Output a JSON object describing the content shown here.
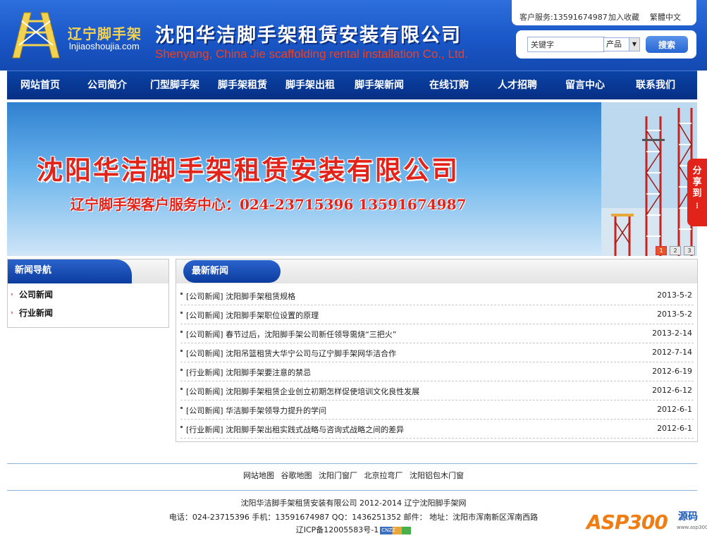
{
  "header": {
    "logo_cn": "辽宁脚手架",
    "logo_url": "lnjiaoshoujia.com",
    "company_cn": "沈阳华洁脚手架租赁安装有限公司",
    "company_en": "Shenyang, China Jie scaffolding rental installation Co., Ltd.",
    "service_phone": "客户服务:13591674987",
    "favorite": "加入收藏",
    "traditional": "繁體中文",
    "search_value": "关键字",
    "search_select": "产品",
    "search_button": "搜索"
  },
  "nav": [
    "网站首页",
    "公司简介",
    "门型脚手架",
    "脚手架租赁",
    "脚手架出租",
    "脚手架新闻",
    "在线订购",
    "人才招聘",
    "留言中心",
    "联系我们"
  ],
  "banner": {
    "title": "沈阳华洁脚手架租赁安装有限公司",
    "subtitle": "辽宁脚手架客户服务中心：024-23715396  13591674987",
    "dots": [
      "1",
      "2",
      "3"
    ],
    "share": "分享到"
  },
  "sidebar": {
    "title": "新闻导航",
    "items": [
      "公司新闻",
      "行业新闻"
    ]
  },
  "news": {
    "title": "最新新闻",
    "items": [
      {
        "title": "[公司新闻] 沈阳脚手架租赁规格",
        "date": "2013-5-2"
      },
      {
        "title": "[公司新闻] 沈阳脚手架职位设置的原理",
        "date": "2013-5-2"
      },
      {
        "title": "[公司新闻] 春节过后，沈阳脚手架公司新任领导需烧“三把火”",
        "date": "2013-2-14"
      },
      {
        "title": "[公司新闻] 沈阳吊篮租赁大华宁公司与辽宁脚手架网华洁合作",
        "date": "2012-7-14"
      },
      {
        "title": "[行业新闻] 沈阳脚手架要注意的禁忌",
        "date": "2012-6-19"
      },
      {
        "title": "[公司新闻] 沈阳脚手架租赁企业创立初期怎样促使培训文化良性发展",
        "date": "2012-6-12"
      },
      {
        "title": "[公司新闻] 华洁脚手架领导力提升的学问",
        "date": "2012-6-1"
      },
      {
        "title": "[行业新闻] 沈阳脚手架出租实践式战略与咨询式战略之间的差异",
        "date": "2012-6-1"
      }
    ]
  },
  "footer": {
    "links": [
      "网站地图",
      "谷歌地图",
      "沈阳门窗厂",
      "北京拉弯厂",
      "沈阳铝包木门窗"
    ],
    "copyright": "沈阳华洁脚手架租赁安装有限公司 2012-2014 辽宁沈阳脚手架网",
    "contact": "电话：024-23715396 手机：13591674987 QQ：1436251352 邮件： 地址：沈阳市浑南新区浑南西路",
    "icp": "辽ICP备12005583号-1",
    "cnzz": "CNZZ"
  },
  "watermark": {
    "main": "ASP300",
    "sub": "源码",
    "url": "www.asp300.com"
  },
  "colors": {
    "header_blue": "#1a57c8",
    "nav_blue": "#072f85",
    "banner_red": "#e2231a",
    "logo_gold": "#f2d250"
  }
}
